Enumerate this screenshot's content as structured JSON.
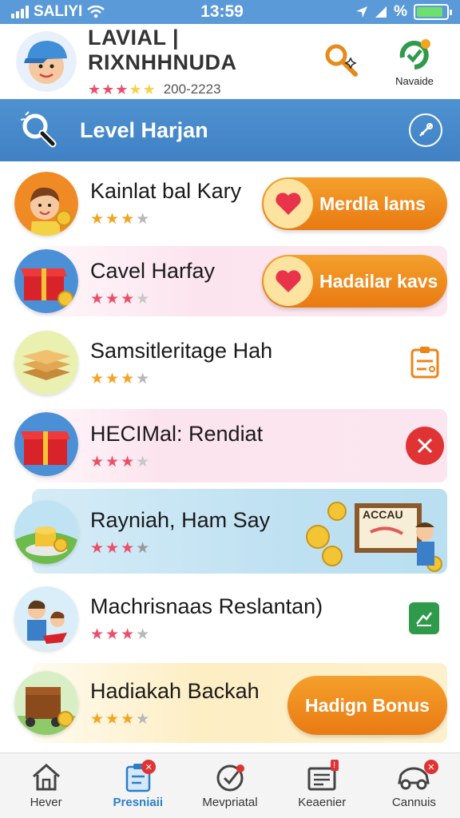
{
  "status_bar": {
    "carrier": "SALIYI",
    "time": "13:59",
    "percent": "%"
  },
  "profile": {
    "name": "LAVIAL | RIXNHHNUDA",
    "code": "200-2223",
    "nav_label": "Navaide",
    "stars_filled": 3
  },
  "level_header": {
    "title": "Level Harjan"
  },
  "items": [
    {
      "title": "Kainlat bal Kary",
      "action": "Merdla lams",
      "stars": 3
    },
    {
      "title": "Cavel Harfay",
      "action": "Hadailar kavs",
      "stars": 3
    },
    {
      "title": "Samsitleritage Hah",
      "stars": 3
    },
    {
      "title": "HECIMal: Rendiat",
      "stars": 3
    },
    {
      "title": "Rayniah, Ham Say",
      "stars": 3,
      "sign_text": "ACCAU"
    },
    {
      "title": "Machrisnaas Reslantan)",
      "stars": 3
    },
    {
      "title": "Hadiakah Backah",
      "action": "Hadign Bonus",
      "stars": 3
    }
  ],
  "bottom_nav": [
    {
      "label": "Hever",
      "icon": "home-icon"
    },
    {
      "label": "Presniaii",
      "icon": "clipboard-icon",
      "active": true
    },
    {
      "label": "Mevpriatal",
      "icon": "checkmark-circle-icon"
    },
    {
      "label": "Keaenier",
      "icon": "news-icon"
    },
    {
      "label": "Cannuis",
      "icon": "car-icon"
    }
  ],
  "colors": {
    "accent_blue": "#4f92d1",
    "orange": "#ee8418",
    "star_gold": "#f3a521",
    "star_pink": "#ec4e6a",
    "red": "#e03434",
    "green": "#2e9a4a"
  }
}
